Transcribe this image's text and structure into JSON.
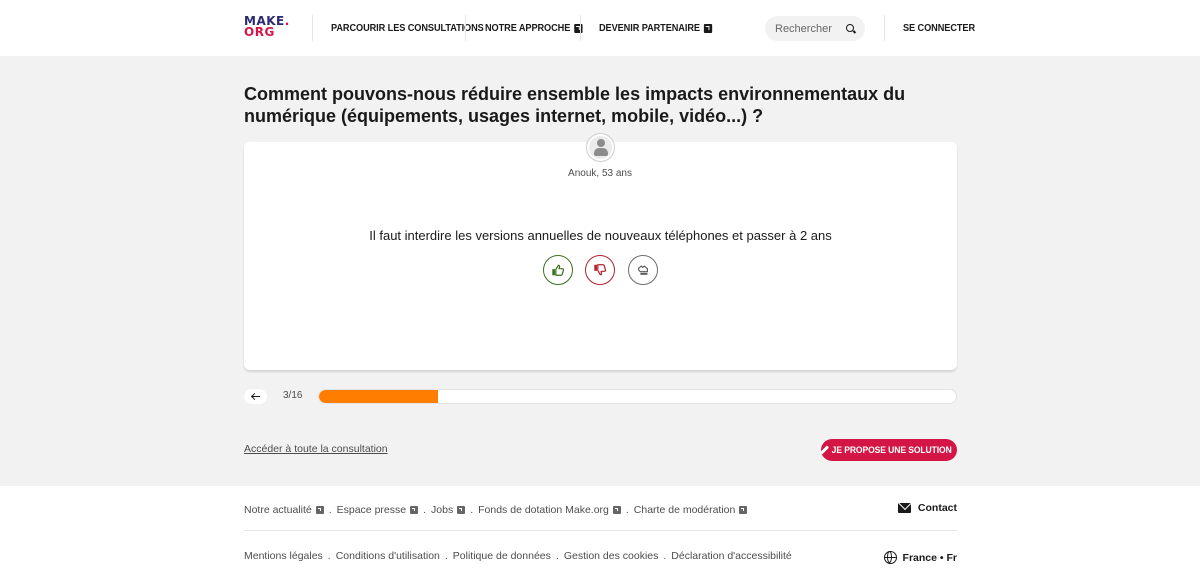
{
  "header": {
    "logo": {
      "line1": "MAKE",
      "dot": ".",
      "line2": "ORG"
    },
    "nav": [
      {
        "label": "PARCOURIR LES CONSULTATIONS",
        "external": false
      },
      {
        "label": "NOTRE APPROCHE",
        "external": true
      },
      {
        "label": "DEVENIR PARTENAIRE",
        "external": true
      }
    ],
    "search": {
      "placeholder": "Rechercher",
      "value": ""
    },
    "login_label": "SE CONNECTER"
  },
  "main": {
    "question": "Comment pouvons-nous réduire ensemble les impacts environnementaux du numérique (équipements, usages internet, mobile, vidéo...) ?",
    "proposal": {
      "author": "Anouk, 53 ans",
      "text": "Il faut interdire les versions annuelles de nouveaux téléphones et passer à 2 ans",
      "votes": [
        {
          "type": "agree",
          "icon": "thumbs-up-icon",
          "color": "#3e6e1e"
        },
        {
          "type": "disagree",
          "icon": "thumbs-down-icon",
          "color": "#b3202e"
        },
        {
          "type": "neutral",
          "icon": "hand-neutral-icon",
          "color": "#6d6d6d"
        }
      ]
    },
    "progress": {
      "current": 3,
      "total": 16,
      "label": "3/16",
      "fraction": 0.1875,
      "color": "#ff7d00"
    },
    "consultation_link": "Accéder à toute la consultation",
    "propose_button": "JE PROPOSE UNE SOLUTION",
    "accent_color": "#d31645"
  },
  "footer": {
    "row1": [
      {
        "label": "Notre actualité",
        "external": true
      },
      {
        "label": "Espace presse",
        "external": true
      },
      {
        "label": "Jobs",
        "external": true
      },
      {
        "label": "Fonds de dotation Make.org",
        "external": true
      },
      {
        "label": "Charte de modération",
        "external": true
      }
    ],
    "row2": [
      {
        "label": "Mentions légales"
      },
      {
        "label": "Conditions d'utilisation"
      },
      {
        "label": "Politique de données"
      },
      {
        "label": "Gestion des cookies"
      },
      {
        "label": "Déclaration d'accessibilité"
      }
    ],
    "separator": ".",
    "contact_label": "Contact",
    "language_label": "France • Fr"
  }
}
